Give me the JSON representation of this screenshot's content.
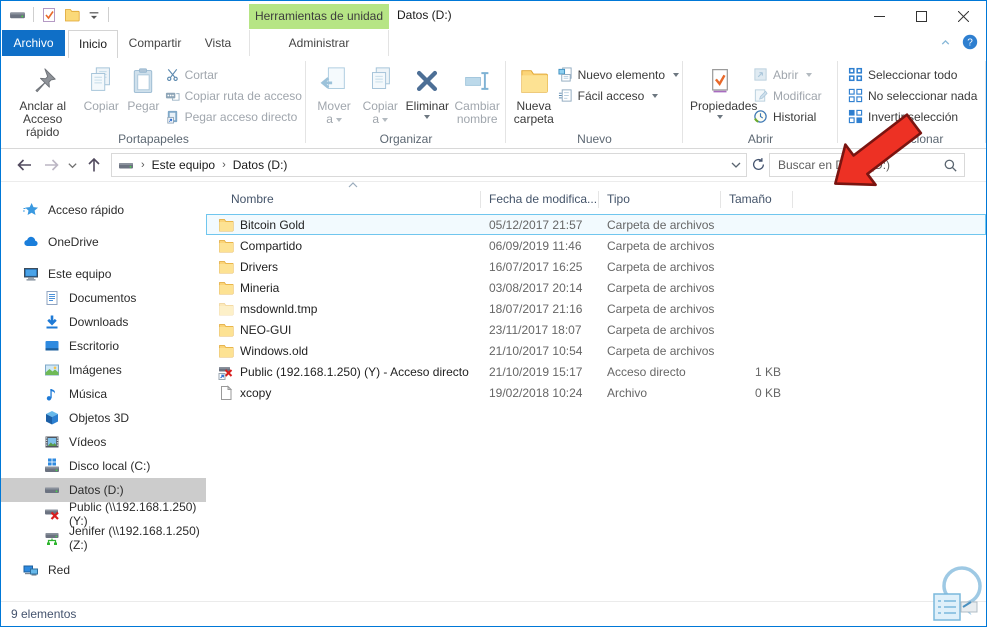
{
  "window": {
    "title": "Datos (D:)",
    "tool_tab": "Herramientas de unidad",
    "status": "9 elementos"
  },
  "tabs": [
    "Archivo",
    "Inicio",
    "Compartir",
    "Vista",
    "Administrar"
  ],
  "ribbon": {
    "groups": [
      {
        "label": "Portapapeles",
        "big": [
          {
            "label": "Anclar al Acceso rápido"
          },
          {
            "label": "Copiar"
          },
          {
            "label": "Pegar"
          }
        ],
        "small": [
          {
            "label": "Cortar"
          },
          {
            "label": "Copiar ruta de acceso"
          },
          {
            "label": "Pegar acceso directo"
          }
        ]
      },
      {
        "label": "Organizar",
        "big": [
          {
            "label": "Mover a"
          },
          {
            "label": "Copiar a"
          },
          {
            "label": "Eliminar"
          },
          {
            "label": "Cambiar nombre"
          }
        ]
      },
      {
        "label": "Nuevo",
        "big": [
          {
            "label": "Nueva carpeta"
          }
        ],
        "small": [
          {
            "label": "Nuevo elemento"
          },
          {
            "label": "Fácil acceso"
          }
        ]
      },
      {
        "label": "Abrir",
        "big": [
          {
            "label": "Propiedades"
          }
        ],
        "small": [
          {
            "label": "Abrir"
          },
          {
            "label": "Modificar"
          },
          {
            "label": "Historial"
          }
        ]
      },
      {
        "label": "Seleccionar",
        "small": [
          {
            "label": "Seleccionar todo"
          },
          {
            "label": "No seleccionar nada"
          },
          {
            "label": "Invertir selección"
          }
        ]
      }
    ]
  },
  "address": {
    "crumbs": [
      "Este equipo",
      "Datos (D:)"
    ],
    "search_placeholder": "Buscar en Datos (D:)"
  },
  "sidebar": {
    "items": [
      {
        "label": "Acceso rápido",
        "icon": "star",
        "level": 0,
        "gap": false
      },
      {
        "label": "OneDrive",
        "icon": "cloud",
        "level": 0,
        "gap": true
      },
      {
        "label": "Este equipo",
        "icon": "monitor",
        "level": 0,
        "gap": true
      },
      {
        "label": "Documentos",
        "icon": "document",
        "level": 1,
        "gap": false
      },
      {
        "label": "Downloads",
        "icon": "download",
        "level": 1,
        "gap": false
      },
      {
        "label": "Escritorio",
        "icon": "desktop",
        "level": 1,
        "gap": false
      },
      {
        "label": "Imágenes",
        "icon": "picture",
        "level": 1,
        "gap": false
      },
      {
        "label": "Música",
        "icon": "music",
        "level": 1,
        "gap": false
      },
      {
        "label": "Objetos 3D",
        "icon": "cube",
        "level": 1,
        "gap": false
      },
      {
        "label": "Vídeos",
        "icon": "video",
        "level": 1,
        "gap": false
      },
      {
        "label": "Disco local (C:)",
        "icon": "drive-os",
        "level": 1,
        "gap": false
      },
      {
        "label": "Datos (D:)",
        "icon": "drive",
        "level": 1,
        "gap": false,
        "selected": true
      },
      {
        "label": "Public (\\\\192.168.1.250) (Y:)",
        "icon": "drive-err",
        "level": 1,
        "gap": false
      },
      {
        "label": "Jenifer (\\\\192.168.1.250) (Z:)",
        "icon": "drive-net",
        "level": 1,
        "gap": false
      },
      {
        "label": "Red",
        "icon": "network",
        "level": 0,
        "gap": true
      }
    ]
  },
  "files": {
    "columns": [
      "Nombre",
      "Fecha de modifica...",
      "Tipo",
      "Tamaño"
    ],
    "rows": [
      {
        "name": "Bitcoin Gold",
        "date": "05/12/2017 21:57",
        "type": "Carpeta de archivos",
        "size": "",
        "icon": "folder",
        "selected": true
      },
      {
        "name": "Compartido",
        "date": "06/09/2019 11:46",
        "type": "Carpeta de archivos",
        "size": "",
        "icon": "folder"
      },
      {
        "name": "Drivers",
        "date": "16/07/2017 16:25",
        "type": "Carpeta de archivos",
        "size": "",
        "icon": "folder"
      },
      {
        "name": "Mineria",
        "date": "03/08/2017 20:14",
        "type": "Carpeta de archivos",
        "size": "",
        "icon": "folder"
      },
      {
        "name": "msdownld.tmp",
        "date": "18/07/2017 21:16",
        "type": "Carpeta de archivos",
        "size": "",
        "icon": "folder-faded"
      },
      {
        "name": "NEO-GUI",
        "date": "23/11/2017 18:07",
        "type": "Carpeta de archivos",
        "size": "",
        "icon": "folder"
      },
      {
        "name": "Windows.old",
        "date": "21/10/2017 10:54",
        "type": "Carpeta de archivos",
        "size": "",
        "icon": "folder"
      },
      {
        "name": "Public (192.168.1.250) (Y) - Acceso directo",
        "date": "21/10/2019 15:17",
        "type": "Acceso directo",
        "size": "1 KB",
        "icon": "shortcut"
      },
      {
        "name": "xcopy",
        "date": "19/02/2018 10:24",
        "type": "Archivo",
        "size": "0 KB",
        "icon": "file"
      }
    ]
  },
  "colors": {
    "accent": "#0078d7",
    "drive_tools_tab": "#b6e585",
    "annotation_arrow": "#ed3124",
    "selected_row_border": "#70c6ee",
    "sidebar_selected_bg": "#cccccc"
  }
}
